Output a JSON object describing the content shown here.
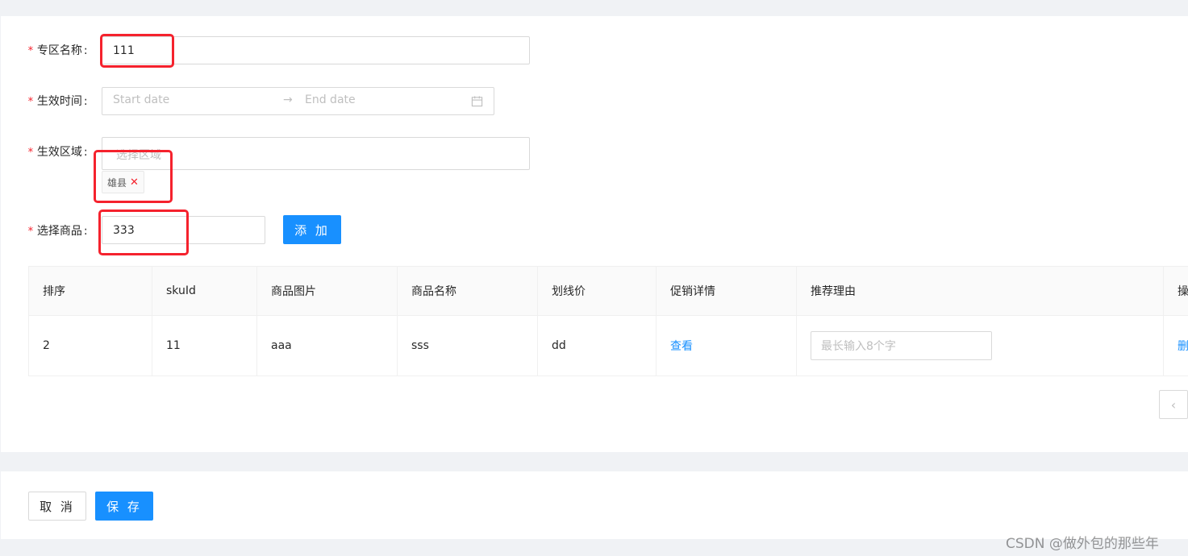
{
  "form": {
    "zone_name": {
      "label": "专区名称",
      "value": "111"
    },
    "effective_time": {
      "label": "生效时间",
      "start_placeholder": "Start date",
      "arrow": "→",
      "end_placeholder": "End date"
    },
    "effective_region": {
      "label": "生效区域",
      "placeholder": "选择区域",
      "tags": [
        "雄县"
      ],
      "tag_close": "✕"
    },
    "select_goods": {
      "label": "选择商品",
      "value": "333",
      "add_label": "添 加"
    },
    "required_mark": "*",
    "colon": ":"
  },
  "table": {
    "headers": [
      "排序",
      "skuId",
      "商品图片",
      "商品名称",
      "划线价",
      "促销详情",
      "推荐理由",
      "操"
    ],
    "rows": [
      {
        "sort": "2",
        "sku_id": "11",
        "image": "aaa",
        "name": "sss",
        "list_price": "dd",
        "promo_link": "查看",
        "reason_placeholder": "最长输入8个字",
        "action": "删"
      }
    ]
  },
  "pagination": {
    "prev_icon": "‹"
  },
  "footer": {
    "cancel_label": "取 消",
    "save_label": "保 存"
  },
  "watermark": "CSDN @做外包的那些年",
  "colors": {
    "primary": "#1890ff",
    "required": "#f5222d",
    "highlight_box": "#f5222d"
  }
}
